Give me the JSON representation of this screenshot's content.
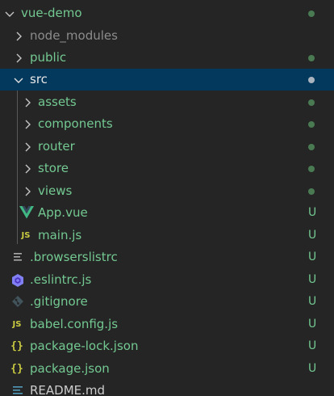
{
  "colors": {
    "background": "#252526",
    "selected_row": "#04395e",
    "untracked_green": "#73c991",
    "folder_dot": "#4a7a52",
    "js_yellow": "#cbcb41",
    "vue_green": "#41b883"
  },
  "tree": {
    "root": {
      "label": "vue-demo",
      "icon": "chevron-down-icon"
    },
    "node_modules": {
      "label": "node_modules",
      "icon": "chevron-right-icon"
    },
    "public": {
      "label": "public",
      "icon": "chevron-right-icon"
    },
    "src": {
      "label": "src",
      "icon": "chevron-down-icon"
    },
    "assets": {
      "label": "assets",
      "icon": "chevron-right-icon"
    },
    "components": {
      "label": "components",
      "icon": "chevron-right-icon"
    },
    "router": {
      "label": "router",
      "icon": "chevron-right-icon"
    },
    "store": {
      "label": "store",
      "icon": "chevron-right-icon"
    },
    "views": {
      "label": "views",
      "icon": "chevron-right-icon"
    },
    "app_vue": {
      "label": "App.vue",
      "icon": "vue-icon",
      "status": "U"
    },
    "main_js": {
      "label": "main.js",
      "icon": "js-icon",
      "icon_text": "JS",
      "status": "U"
    },
    "browserslistrc": {
      "label": ".browserslistrc",
      "icon": "list-lines-icon",
      "status": "U"
    },
    "eslintrc": {
      "label": ".eslintrc.js",
      "icon": "eslint-icon",
      "status": "U"
    },
    "gitignore": {
      "label": ".gitignore",
      "icon": "git-icon",
      "status": "U"
    },
    "babel_config": {
      "label": "babel.config.js",
      "icon": "js-icon",
      "icon_text": "JS",
      "status": "U"
    },
    "package_lock": {
      "label": "package-lock.json",
      "icon": "json-icon",
      "icon_text": "{}",
      "status": "U"
    },
    "package_json": {
      "label": "package.json",
      "icon": "json-icon",
      "icon_text": "{}",
      "status": "U"
    },
    "readme": {
      "label": "README.md",
      "icon": "info-icon"
    }
  }
}
